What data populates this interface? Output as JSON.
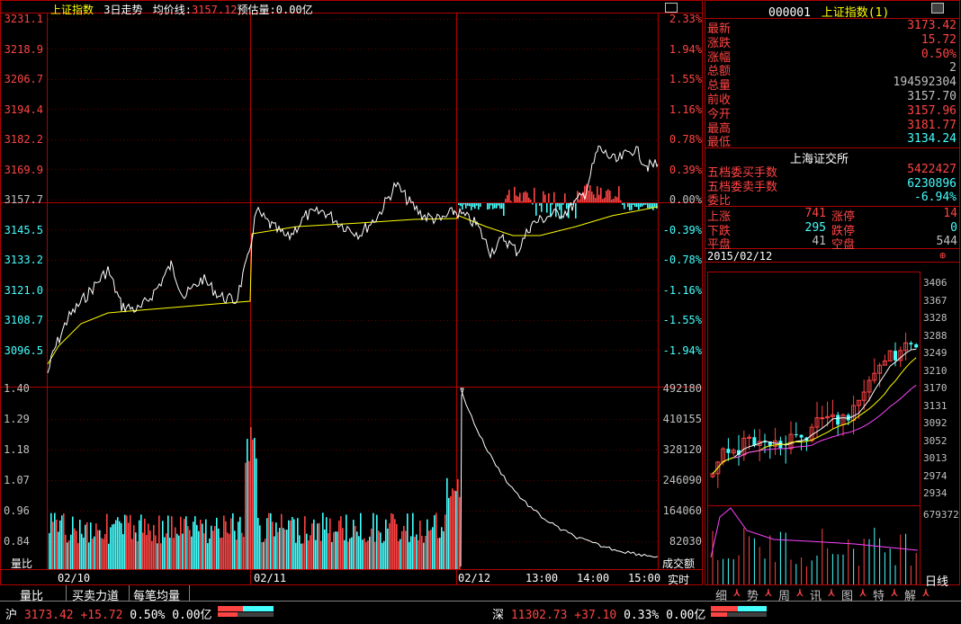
{
  "header": {
    "index_name": "上证指数",
    "period": "3日走势",
    "avg_label": "均价线:",
    "avg_value": "3157.12",
    "estimate_label": "预估量:",
    "estimate_value": "0.00亿"
  },
  "price_axis_left": [
    "3231.1",
    "3218.9",
    "3206.7",
    "3194.4",
    "3182.2",
    "3169.9",
    "3157.7",
    "3145.5",
    "3133.2",
    "3121.0",
    "3108.7",
    "3096.5"
  ],
  "price_axis_right": [
    "2.33%",
    "1.94%",
    "1.55%",
    "1.16%",
    "0.78%",
    "0.39%",
    "0.00%",
    "-0.39%",
    "-0.78%",
    "-1.16%",
    "-1.55%",
    "-1.94%"
  ],
  "ratio_axis": [
    "1.40",
    "1.29",
    "1.18",
    "1.07",
    "0.96",
    "0.84"
  ],
  "volume_axis": [
    "492180",
    "410155",
    "328120",
    "246090",
    "164060",
    "82030"
  ],
  "volume_labels": {
    "left": "量比",
    "right": "成交额"
  },
  "date_axis": [
    "02/10",
    "02/11",
    "02/12",
    "13:00",
    "14:00",
    "15:00"
  ],
  "realtime_label": "实时",
  "bottom_tabs": [
    "量比",
    "买卖力道",
    "每笔均量"
  ],
  "right_panel": {
    "code": "000001",
    "name": "上证指数(1)",
    "rows": [
      {
        "k": "最新",
        "v": "3173.42",
        "c": "red"
      },
      {
        "k": "涨跌",
        "v": "15.72",
        "c": "red"
      },
      {
        "k": "涨幅",
        "v": "0.50%",
        "c": "red"
      },
      {
        "k": "总额",
        "v": "2",
        "c": "gray"
      },
      {
        "k": "总量",
        "v": "194592304",
        "c": "gray"
      },
      {
        "k": "前收",
        "v": "3157.70",
        "c": "gray"
      },
      {
        "k": "今开",
        "v": "3157.96",
        "c": "red"
      },
      {
        "k": "最高",
        "v": "3181.77",
        "c": "red"
      },
      {
        "k": "最低",
        "v": "3134.24",
        "c": "cyan"
      }
    ],
    "exchange": "上海证交所",
    "orders": [
      {
        "k": "五档委买手数",
        "v": "5422427",
        "c": "red"
      },
      {
        "k": "五档委卖手数",
        "v": "6230896",
        "c": "cyan"
      },
      {
        "k": "委比",
        "v": "-6.94%",
        "c": "cyan"
      }
    ],
    "breadth": [
      {
        "k1": "上涨",
        "v1": "741",
        "c1": "red",
        "k2": "涨停",
        "v2": "14",
        "c2": "red"
      },
      {
        "k1": "下跌",
        "v1": "295",
        "c1": "cyan",
        "k2": "跌停",
        "v2": "0",
        "c2": "cyan"
      },
      {
        "k1": "平盘",
        "v1": "41",
        "c1": "gray",
        "k2": "空盘",
        "v2": "544",
        "c2": "gray"
      }
    ],
    "kline_date": "2015/02/12",
    "kline_axis": [
      "3406",
      "3367",
      "3328",
      "3288",
      "3249",
      "3210",
      "3170",
      "3131",
      "3092",
      "3052",
      "3013",
      "2974",
      "2934"
    ],
    "kline_vol_axis": "679372",
    "kline_period": "日线",
    "tabs": [
      "细",
      "势",
      "周",
      "讯",
      "图",
      "特",
      "解"
    ]
  },
  "status_bar": {
    "sh_label": "沪",
    "sh_price": "3173.42",
    "sh_change": "+15.72",
    "sh_pct": "0.50%",
    "sh_amount": "0.00亿",
    "sz_label": "深",
    "sz_price": "11302.73",
    "sz_change": "+37.10",
    "sz_pct": "0.33%",
    "sz_amount": "0.00亿"
  },
  "colors": {
    "up": "#ff4444",
    "down": "#44ffff",
    "grid": "#b00000",
    "avg": "#ffff00",
    "price": "#ffffff"
  }
}
